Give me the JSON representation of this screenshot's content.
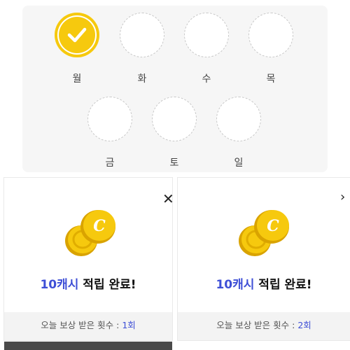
{
  "days": [
    {
      "label": "월",
      "checked": true
    },
    {
      "label": "화",
      "checked": false
    },
    {
      "label": "수",
      "checked": false
    },
    {
      "label": "목",
      "checked": false
    },
    {
      "label": "금",
      "checked": false
    },
    {
      "label": "토",
      "checked": false
    },
    {
      "label": "일",
      "checked": false
    }
  ],
  "colors": {
    "accent_yellow": "#f6c90e",
    "accent_blue": "#3e4fd6"
  },
  "rewards": [
    {
      "amount": "10캐시",
      "suffix": " 적립 완료!",
      "count_label": "오늘 보상 받은 횟수 : ",
      "count_value": "1회",
      "close_icon": "close-icon"
    },
    {
      "amount": "10캐시",
      "suffix": " 적립 완료!",
      "count_label": "오늘 보상 받은 횟수 : ",
      "count_value": "2회",
      "close_icon": "chevron-right-icon"
    }
  ],
  "icons": {
    "coin": "C"
  }
}
